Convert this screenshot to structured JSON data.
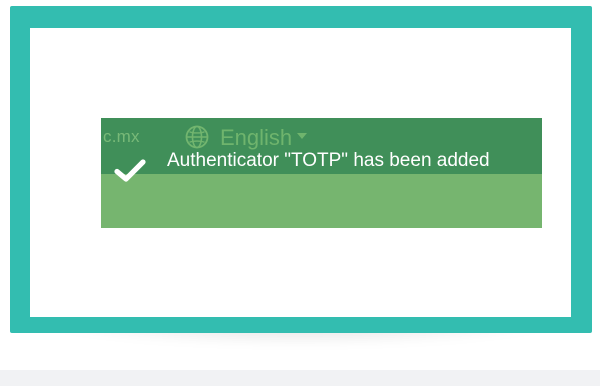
{
  "background_nav": {
    "domain_text": "c.mx",
    "globe_icon": "globe-icon",
    "language_label": "English",
    "caret_icon": "caret-down-icon"
  },
  "notification": {
    "icon": "check-icon",
    "message": "Authenticator \"TOTP\" has been added"
  },
  "colors": {
    "frame": "#33bdb0",
    "top_band": "#408f59",
    "bottom_band": "#76b56f",
    "text": "#ffffff"
  }
}
